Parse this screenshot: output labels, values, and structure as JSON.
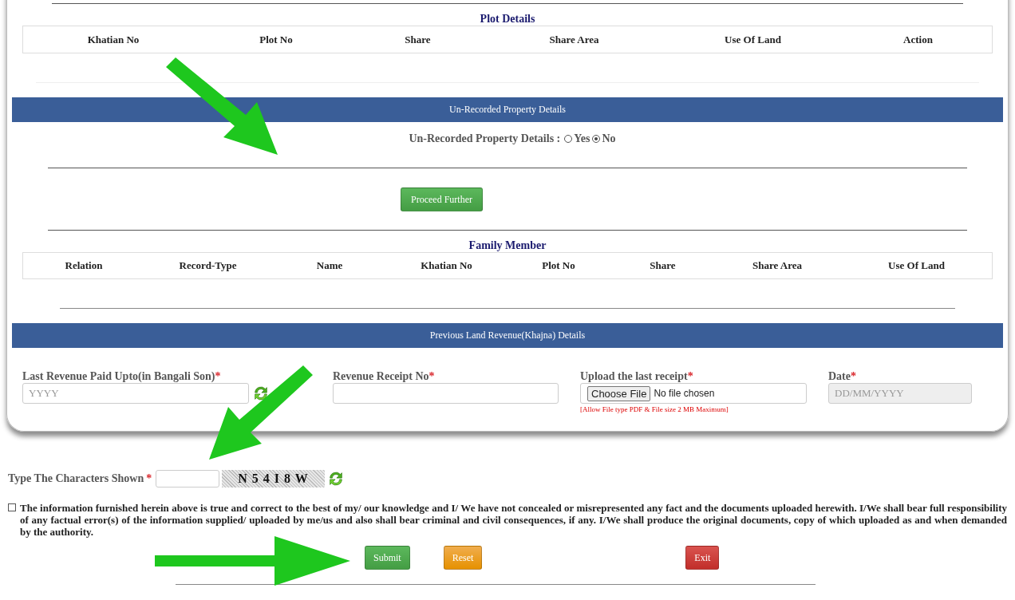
{
  "plot_details": {
    "title": "Plot Details",
    "columns": [
      "Khatian No",
      "Plot No",
      "Share",
      "Share Area",
      "Use Of Land",
      "Action"
    ]
  },
  "unrecorded": {
    "banner": "Un-Recorded Property Details",
    "label": "Un-Recorded Property Details :",
    "options": [
      {
        "label": "Yes",
        "selected": false
      },
      {
        "label": "No",
        "selected": true
      }
    ],
    "proceed_button": "Proceed Further"
  },
  "family_member": {
    "title": "Family Member",
    "columns": [
      "Relation",
      "Record-Type",
      "Name",
      "Khatian No",
      "Plot No",
      "Share",
      "Share Area",
      "Use Of Land"
    ]
  },
  "revenue": {
    "banner": "Previous Land Revenue(Khajna) Details",
    "fields": [
      {
        "kind": "text",
        "label": "Last Revenue Paid Upto(in Bangali Son)",
        "required_mark": "*",
        "placeholder": "YYYY"
      },
      {
        "kind": "text",
        "label": "Revenue Receipt No",
        "required_mark": "*"
      },
      {
        "kind": "file",
        "label": "Upload the last receipt",
        "required_mark": "*",
        "button": "Choose File",
        "status": "No file chosen",
        "note": "[Allow File type PDF & File size 2 MB Maximum]"
      },
      {
        "kind": "date",
        "label": "Date",
        "required_mark": "*",
        "placeholder": "DD/MM/YYYY"
      }
    ]
  },
  "captcha": {
    "label": "Type The Characters Shown",
    "required_mark": "*",
    "code": "N 5 4 I 8 W"
  },
  "declaration": {
    "checked": false,
    "text": "The information furnished herein above is true and correct to the best of my/ our knowledge and I/ We have not concealed or misrepresented any fact and the documents uploaded herewith. I/We shall bear full responsibility of any factual error(s) of the information supplied/ uploaded by me/us and also shall bear criminal and civil consequences, if any. I/We shall produce the original documents, copy of which uploaded as and when demanded by the authority."
  },
  "buttons": [
    {
      "kind": "submit",
      "label": "Submit"
    },
    {
      "kind": "reset",
      "label": "Reset"
    },
    {
      "kind": "exit",
      "label": "Exit"
    }
  ]
}
